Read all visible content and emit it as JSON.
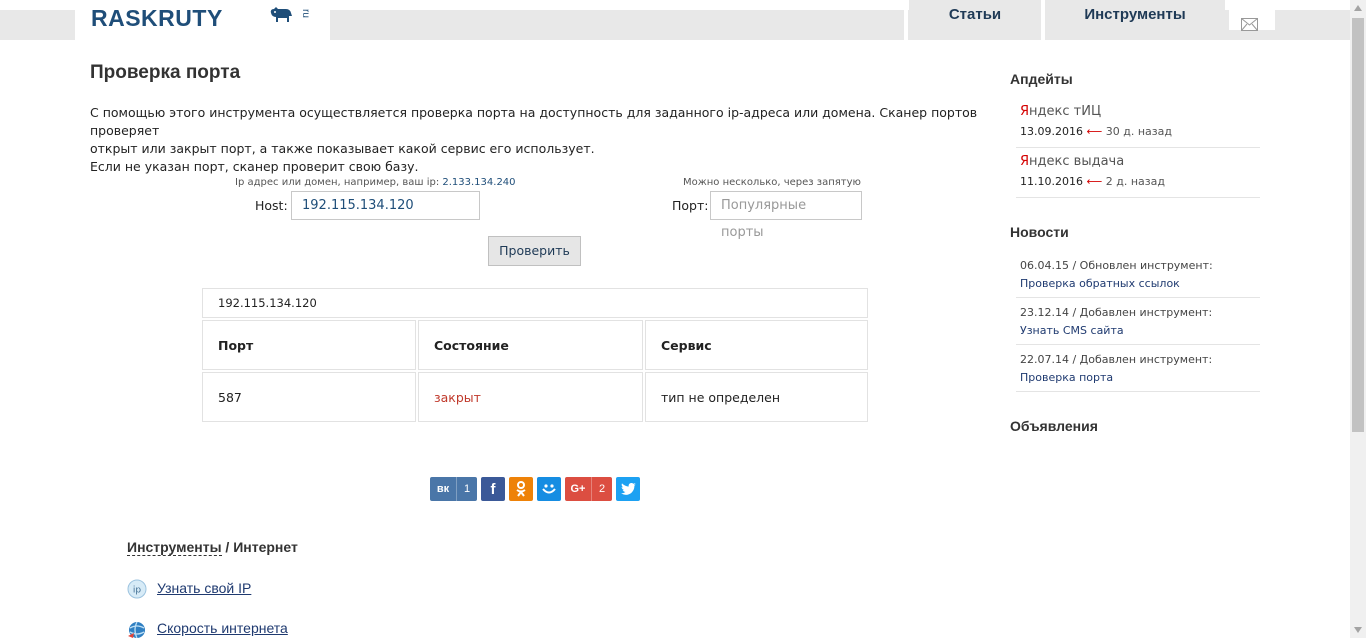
{
  "header": {
    "logo_text": "RASKRUTY",
    "logo_suffix": "ru",
    "nav": [
      "Статьи",
      "Инструменты"
    ]
  },
  "page": {
    "title": "Проверка порта",
    "desc_line1": "С помощью этого инструмента осуществляется проверка порта на доступность для заданного ip-адреса или домена. Сканер портов проверяет",
    "desc_line2": "открыт или закрыт порт, а также показывает какой сервис его использует.",
    "desc_line3": "Если не указан порт, сканер проверит свою базу."
  },
  "form": {
    "host_hint": "Ip адрес или домен, например, ваш ip:",
    "host_hint_ip": "2.133.134.240",
    "host_label": "Host:",
    "host_value": "192.115.134.120",
    "port_hint": "Можно несколько, через запятую",
    "port_label": "Порт:",
    "port_placeholder": "Популярные порты",
    "submit_label": "Проверить"
  },
  "result": {
    "host": "192.115.134.120",
    "headers": [
      "Порт",
      "Состояние",
      "Сервис"
    ],
    "rows": [
      {
        "port": "587",
        "state": "закрыт",
        "service": "тип не определен"
      }
    ]
  },
  "social": {
    "vk_count": "1",
    "gplus_label": "G+",
    "gplus_count": "2"
  },
  "category": {
    "link": "Инструменты",
    "separator": " / ",
    "name": "Интернет",
    "tools": [
      "Узнать свой IP",
      "Скорость интернета"
    ]
  },
  "sidebar": {
    "updates_title": "Апдейты",
    "updates": [
      {
        "ya": "Я",
        "name": "ндекс тИЦ",
        "date": "13.09.2016",
        "ago": "30 д. назад"
      },
      {
        "ya": "Я",
        "name": "ндекс выдача",
        "date": "11.10.2016",
        "ago": "2 д. назад"
      }
    ],
    "news_title": "Новости",
    "news": [
      {
        "meta": "06.04.15 / Обновлен инструмент:",
        "link": "Проверка обратных ссылок"
      },
      {
        "meta": "23.12.14 / Добавлен инструмент:",
        "link": "Узнать CMS сайта"
      },
      {
        "meta": "22.07.14 / Добавлен инструмент:",
        "link": "Проверка порта"
      }
    ],
    "ads_title": "Объявления"
  },
  "colors": {
    "brand": "#1f4e79",
    "closed": "#c0392b",
    "vk": "#4a76a8",
    "fb": "#3b5998",
    "ok": "#ee8208",
    "mm": "#168de2",
    "gplus": "#dc4e41",
    "tw": "#1da1f2"
  }
}
